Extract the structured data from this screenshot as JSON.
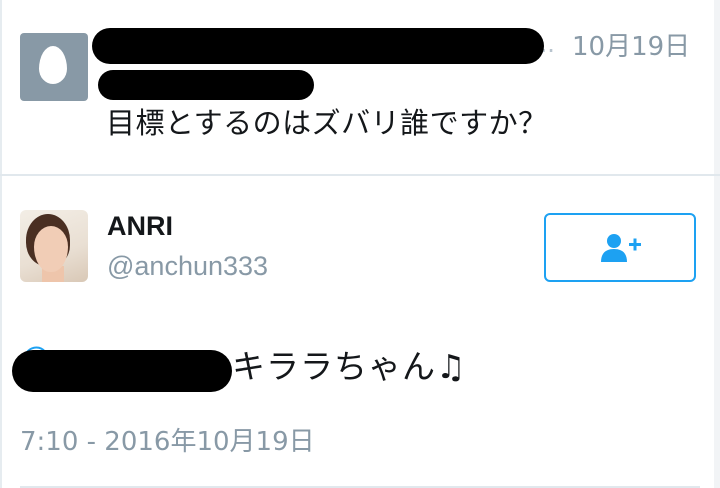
{
  "reply": {
    "avatar_icon": "default-egg-avatar",
    "avatar_color": "#8899a6",
    "screen_name_partial": "@...",
    "time": "10月19日",
    "text": "目標とするのはズバリ誰ですか？"
  },
  "tweet": {
    "display_name": "ANRI",
    "screen_name": "@anchun333",
    "follow_icon": "add-user-icon",
    "mention_partial": "@",
    "text": "キララちゃん♫",
    "timestamp": "7:10 - 2016年10月19日"
  },
  "colors": {
    "accent": "#1da1f2",
    "secondary_text": "#8899a6",
    "primary_text": "#14171a",
    "divider": "#e1e8ed"
  }
}
